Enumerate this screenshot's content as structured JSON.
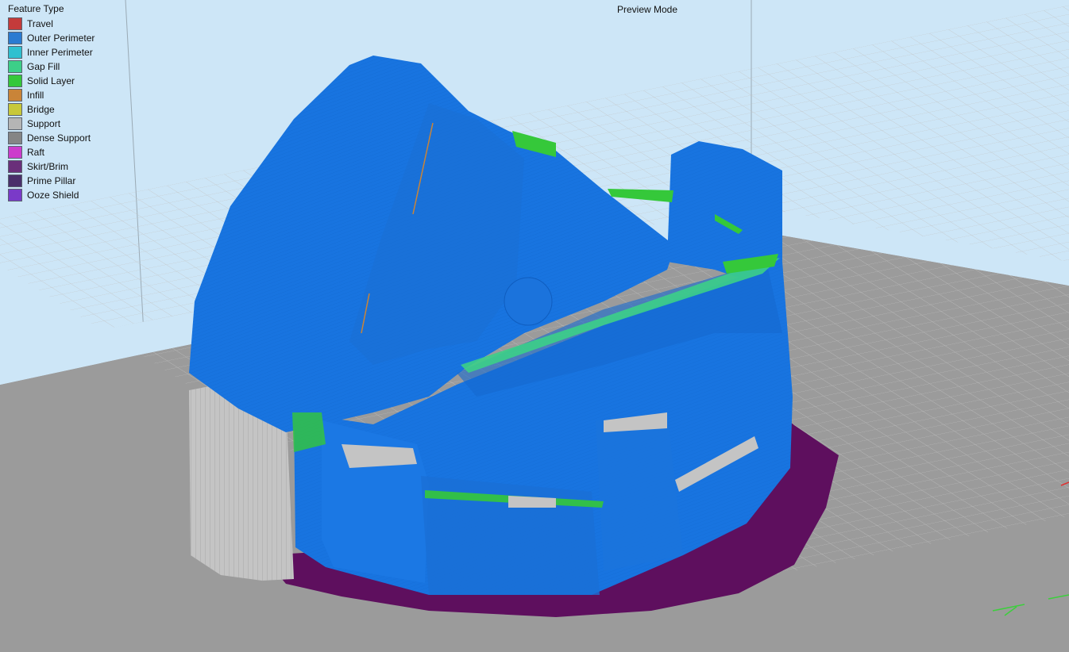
{
  "legend": {
    "title": "Feature Type",
    "items": [
      {
        "label": "Travel",
        "color": "#c43b3b",
        "icon": "travel-swatch"
      },
      {
        "label": "Outer Perimeter",
        "color": "#2a7bd1",
        "icon": "outer-perimeter-swatch"
      },
      {
        "label": "Inner Perimeter",
        "color": "#2fc0d0",
        "icon": "inner-perimeter-swatch"
      },
      {
        "label": "Gap Fill",
        "color": "#3ccf88",
        "icon": "gap-fill-swatch"
      },
      {
        "label": "Solid Layer",
        "color": "#35c83a",
        "icon": "solid-layer-swatch"
      },
      {
        "label": "Infill",
        "color": "#c98438",
        "icon": "infill-swatch"
      },
      {
        "label": "Bridge",
        "color": "#c8c83a",
        "icon": "bridge-swatch"
      },
      {
        "label": "Support",
        "color": "#b5b5b5",
        "icon": "support-swatch"
      },
      {
        "label": "Dense Support",
        "color": "#858585",
        "icon": "dense-support-swatch"
      },
      {
        "label": "Raft",
        "color": "#cc3ccc",
        "icon": "raft-swatch"
      },
      {
        "label": "Skirt/Brim",
        "color": "#6a2f7a",
        "icon": "skirt-brim-swatch"
      },
      {
        "label": "Prime Pillar",
        "color": "#4a2f6a",
        "icon": "prime-pillar-swatch"
      },
      {
        "label": "Ooze Shield",
        "color": "#7a3ac8",
        "icon": "ooze-shield-swatch"
      }
    ]
  },
  "mode_label": "Preview Mode",
  "colors": {
    "background": "#cde6f7",
    "bed": "#9b9b9b",
    "bed_grid": "#c2c2c2",
    "model_blue": "#1874e0",
    "model_blue_dark": "#0f5dbf",
    "brim": "#5e0f5e",
    "support": "#c4c4c4",
    "solid_layer": "#35c83a",
    "gap_fill": "#3ccf88",
    "infill": "#c98438"
  }
}
